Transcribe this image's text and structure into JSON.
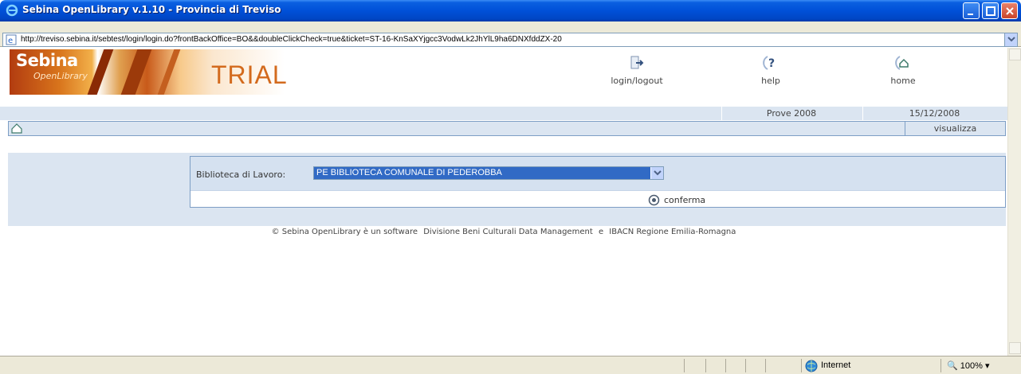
{
  "window": {
    "title": "Sebina OpenLibrary v.1.10 - Provincia di Treviso"
  },
  "address": {
    "url": "http://treviso.sebina.it/sebtest/login/login.do?frontBackOffice=BO&&doubleClickCheck=true&ticket=ST-16-KnSaXYjgcc3VodwLk2JhYlL9ha6DNXfddZX-20"
  },
  "header": {
    "brand": "Sebina",
    "brand_sub": "OpenLibrary",
    "edition": "TRIAL",
    "nav": [
      {
        "label": "login/logout",
        "icon": "login-logout-icon"
      },
      {
        "label": "help",
        "icon": "help-icon"
      },
      {
        "label": "home",
        "icon": "home-icon"
      }
    ]
  },
  "info": {
    "year_label": "Prove 2008",
    "date": "15/12/2008"
  },
  "toolbar": {
    "view_label": "visualizza"
  },
  "form": {
    "library_label": "Biblioteca di Lavoro:",
    "library_value": "PE BIBLIOTECA COMUNALE DI PEDEROBBA",
    "confirm_label": "conferma"
  },
  "footer": {
    "text": "© Sebina OpenLibrary è un software",
    "org1": "Divisione Beni Culturali Data Management",
    "conj": "e",
    "org2": "IBACN Regione Emilia-Romagna"
  },
  "status": {
    "zone": "Internet",
    "zoom": "100%"
  },
  "colors": {
    "accent": "#d36a1d",
    "panel": "#dbe5f1",
    "selection": "#316ac5"
  }
}
